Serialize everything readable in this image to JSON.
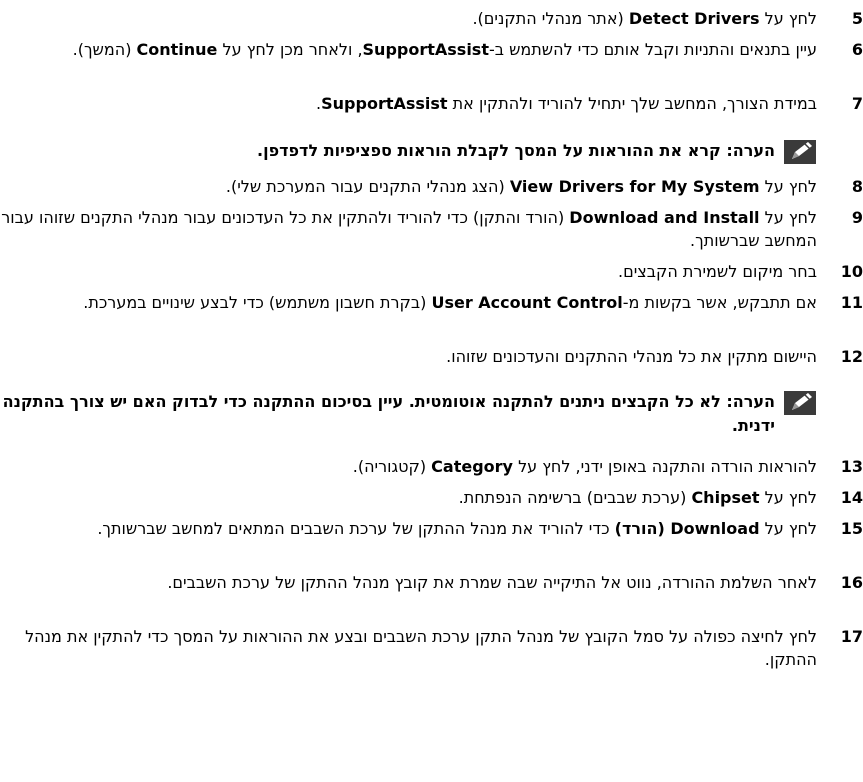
{
  "steps": [
    {
      "num": "5",
      "pre": "לחץ על ",
      "b1": "Detect Drivers",
      "post": " (אתר מנהלי התקנים)."
    },
    {
      "num": "6",
      "pre": "עיין בתנאים והתניות וקבל אותם כדי להשתמש ב-",
      "b1": "SupportAssist",
      "mid": ", ולאחר מכן לחץ על ",
      "b2": "Continue",
      "post": " (המשך)."
    },
    {
      "num": "7",
      "pre": "במידת הצורך, המחשב שלך יתחיל להוריד ולהתקין את ",
      "b1": "SupportAssist",
      "post": "."
    },
    {
      "num": "8",
      "pre": "לחץ על ",
      "b1": "View Drivers for My System",
      "post": " (הצג מנהלי התקנים עבור המערכת שלי)."
    },
    {
      "num": "9",
      "pre": "לחץ על ",
      "b1": "Download and Install",
      "post": " (הורד והתקן) כדי להוריד ולהתקין את כל העדכונים עבור מנהלי התקנים שזוהו עבור המחשב שברשותך."
    },
    {
      "num": "10",
      "pre": "בחר מיקום לשמירת הקבצים.",
      "b1": "",
      "post": ""
    },
    {
      "num": "11",
      "pre": "אם תתבקש, אשר בקשות מ-",
      "b1": "User Account Control",
      "post": " (בקרת חשבון משתמש) כדי לבצע שינויים במערכת."
    },
    {
      "num": "12",
      "pre": "היישום מתקין את כל מנהלי ההתקנים והעדכונים שזוהו.",
      "b1": "",
      "post": ""
    },
    {
      "num": "13",
      "pre": "להוראות הורדה והתקנה באופן ידני, לחץ על ",
      "b1": "Category",
      "post": " (קטגוריה)."
    },
    {
      "num": "14",
      "pre": "לחץ על ",
      "b1": "Chipset",
      "post": " (ערכת שבבים) ברשימה הנפתחת."
    },
    {
      "num": "15",
      "pre": "לחץ על ",
      "b1": "Download (הורד)",
      "post": " כדי להוריד את מנהל ההתקן של ערכת השבבים המתאים למחשב שברשותך."
    },
    {
      "num": "16",
      "pre": "לאחר השלמת ההורדה, נווט אל התיקייה שבה שמרת את קובץ מנהל ההתקן של ערכת השבבים.",
      "b1": "",
      "post": ""
    },
    {
      "num": "17",
      "pre": "לחץ לחיצה כפולה על סמל הקובץ של מנהל התקן ערכת השבבים ובצע את ההוראות על המסך כדי להתקין את מנהל ההתקן.",
      "b1": "",
      "post": ""
    }
  ],
  "notes": [
    {
      "text": "הערה: קרא את ההוראות על המסך לקבלת הוראות ספציפיות לדפדפן."
    },
    {
      "text": "הערה: לא כל הקבצים ניתנים להתקנה אוטומטית. עיין בסיכום ההתקנה כדי לבדוק האם יש צורך בהתקנה ידנית."
    }
  ]
}
